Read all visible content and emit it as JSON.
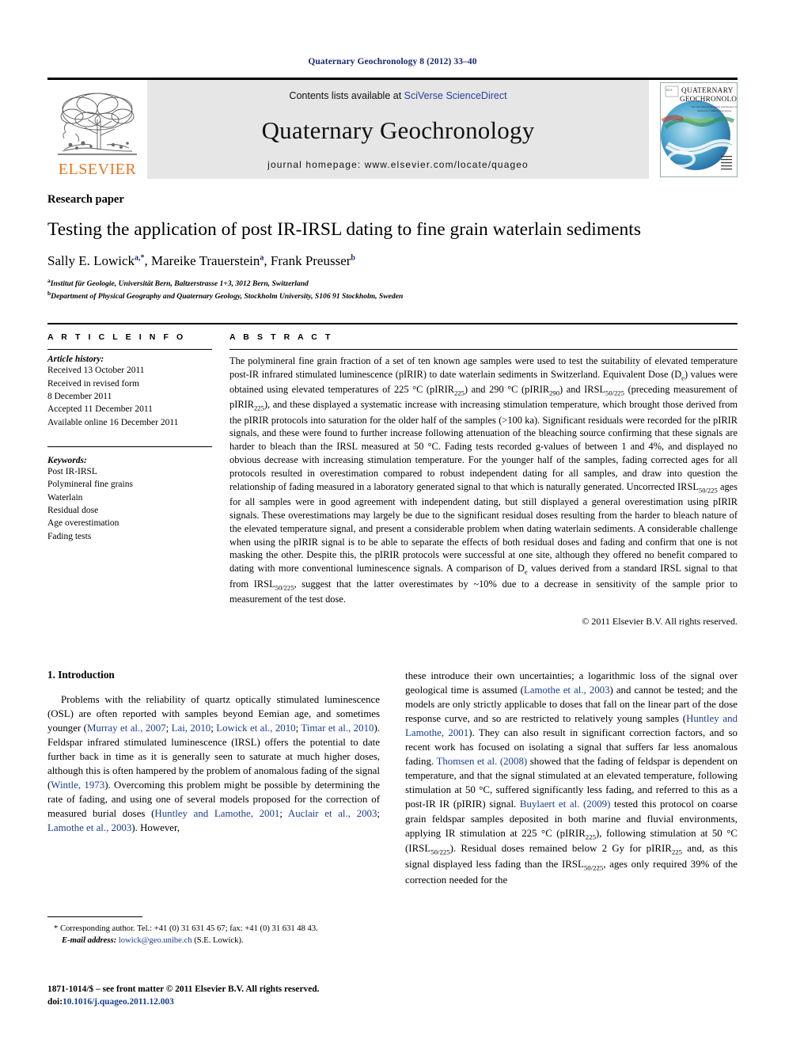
{
  "running_head": "Quaternary Geochronology 8 (2012) 33–40",
  "masthead": {
    "publisher_name": "ELSEVIER",
    "contents_prefix": "Contents lists available at ",
    "contents_link": "SciVerse ScienceDirect",
    "journal_title": "Quaternary Geochronology",
    "homepage": "journal homepage: www.elsevier.com/locate/quageo",
    "cover_line1": "QUATERNARY",
    "cover_line2": "GEOCHRONOLOGY",
    "cover_sub1": "The International Research and Review Journal on",
    "cover_sub2": "Advances in Dating Techniques"
  },
  "article": {
    "kicker": "Research paper",
    "title": "Testing the application of post IR-IRSL dating to fine grain waterlain sediments",
    "authors": [
      {
        "name": "Sally E. Lowick",
        "marks": "a,*"
      },
      {
        "name": "Mareike Trauerstein",
        "marks": "a"
      },
      {
        "name": "Frank Preusser",
        "marks": "b"
      }
    ],
    "affiliations": [
      {
        "mark": "a",
        "text": "Institut für Geologie, Universität Bern, Baltzerstrasse 1+3, 3012 Bern, Switzerland"
      },
      {
        "mark": "b",
        "text": "Department of Physical Geography and Quaternary Geology, Stockholm University, S106 91 Stockholm, Sweden"
      }
    ]
  },
  "article_info": {
    "heading": "A R T I C L E  I N F O",
    "history_label": "Article history:",
    "history": [
      "Received 13 October 2011",
      "Received in revised form",
      "8 December 2011",
      "Accepted 11 December 2011",
      "Available online 16 December 2011"
    ],
    "keywords_label": "Keywords:",
    "keywords": [
      "Post IR-IRSL",
      "Polymineral fine grains",
      "Waterlain",
      "Residual dose",
      "Age overestimation",
      "Fading tests"
    ]
  },
  "abstract": {
    "heading": "A B S T R A C T",
    "paragraphs": [
      "The polymineral fine grain fraction of a set of ten known age samples were used to test the suitability of elevated temperature post-IR infrared stimulated luminescence (pIRIR) to date waterlain sediments in Switzerland. Equivalent Dose (D<sub>e</sub>) values were obtained using elevated temperatures of 225 °C (pIRIR<sub>225</sub>) and 290 °C (pIRIR<sub>290</sub>) and IRSL<sub>50/225</sub> (preceding measurement of pIRIR<sub>225</sub>), and these displayed a systematic increase with increasing stimulation temperature, which brought those derived from the pIRIR protocols into saturation for the older half of the samples (&gt;100 ka). Significant residuals were recorded for the pIRIR signals, and these were found to further increase following attenuation of the bleaching source confirming that these signals are harder to bleach than the IRSL measured at 50 °C. Fading tests recorded g-values of between 1 and 4%, and displayed no obvious decrease with increasing stimulation temperature. For the younger half of the samples, fading corrected ages for all protocols resulted in overestimation compared to robust independent dating for all samples, and draw into question the relationship of fading measured in a laboratory generated signal to that which is naturally generated. Uncorrected IRSL<sub>50/225</sub> ages for all samples were in good agreement with independent dating, but still displayed a general overestimation using pIRIR signals. These overestimations may largely be due to the significant residual doses resulting from the harder to bleach nature of the elevated temperature signal, and present a considerable problem when dating waterlain sediments. A considerable challenge when using the pIRIR signal is to be able to separate the effects of both residual doses and fading and confirm that one is not masking the other. Despite this, the pIRIR protocols were successful at one site, although they offered no benefit compared to dating with more conventional luminescence signals. A comparison of D<sub>e</sub> values derived from a standard IRSL signal to that from IRSL<sub>50/225</sub>, suggest that the latter overestimates by ~10% due to a decrease in sensitivity of the sample prior to measurement of the test dose."
    ],
    "copyright": "© 2011 Elsevier B.V. All rights reserved."
  },
  "introduction": {
    "heading": "1.  Introduction",
    "left_paragraph": "Problems with the reliability of quartz optically stimulated luminescence (OSL) are often reported with samples beyond Eemian age, and sometimes younger (<span class=\"ref\">Murray et al., 2007</span>; <span class=\"ref\">Lai, 2010</span>; <span class=\"ref\">Lowick et al., 2010</span>; <span class=\"ref\">Timar et al., 2010</span>). Feldspar infrared stimulated luminescence (IRSL) offers the potential to date further back in time as it is generally seen to saturate at much higher doses, although this is often hampered by the problem of anomalous fading of the signal (<span class=\"ref\">Wintle, 1973</span>). Overcoming this problem might be possible by determining the rate of fading, and using one of several models proposed for the correction of measured burial doses (<span class=\"ref\">Huntley and Lamothe, 2001</span>; <span class=\"ref\">Auclair et al., 2003</span>; <span class=\"ref\">Lamothe et al., 2003</span>). However,",
    "right_paragraph": "these introduce their own uncertainties; a logarithmic loss of the signal over geological time is assumed (<span class=\"ref\">Lamothe et al., 2003</span>) and cannot be tested; and the models are only strictly applicable to doses that fall on the linear part of the dose response curve, and so are restricted to relatively young samples (<span class=\"ref\">Huntley and Lamothe, 2001</span>). They can also result in significant correction factors, and so recent work has focused on isolating a signal that suffers far less anomalous fading. <span class=\"ref\">Thomsen et al. (2008)</span> showed that the fading of feldspar is dependent on temperature, and that the signal stimulated at an elevated temperature, following stimulation at 50 °C, suffered significantly less fading, and referred to this as a post-IR IR (pIRIR) signal. <span class=\"ref\">Buylaert et al. (2009)</span> tested this protocol on coarse grain feldspar samples deposited in both marine and fluvial environments, applying IR stimulation at 225 °C (pIRIR<sub>225</sub>), following stimulation at 50 °C (IRSL<sub>50/225</sub>). Residual doses remained below 2 Gy for pIRIR<sub>225</sub> and, as this signal displayed less fading than the IRSL<sub>50/225</sub>, ages only required 39% of the correction needed for the"
  },
  "footnote": {
    "corresponding": "* Corresponding author. Tel.: +41 (0) 31 631 45 67; fax: +41 (0) 31 631 48 43.",
    "email_label": "E-mail address:",
    "email": "lowick@geo.unibe.ch",
    "email_suffix": "(S.E. Lowick)."
  },
  "issn": {
    "line1_prefix": "1871-1014/$ – see front matter © 2011 Elsevier B.V. All rights reserved.",
    "doi_label": "doi:",
    "doi_value": "10.1016/j.quageo.2011.12.003"
  },
  "colors": {
    "elsevier_orange": "#E87722",
    "link_blue": "#1a3d8f",
    "running_head_navy": "#1a2a6c",
    "masthead_gray": "#e6e6e6"
  }
}
